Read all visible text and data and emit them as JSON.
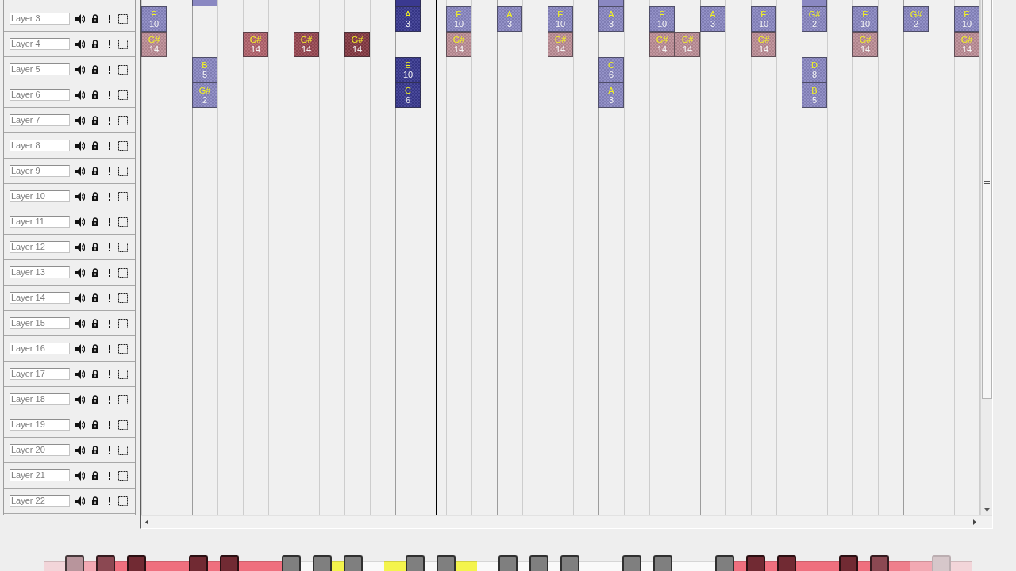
{
  "cut_off_layer": {
    "cells": [
      null,
      null,
      {
        "color": "#8a88c2"
      },
      null,
      null,
      null,
      null,
      null,
      null,
      null,
      {
        "color": "#3a3990"
      },
      null,
      null,
      null,
      null,
      null,
      null,
      null,
      {
        "color": "#8a88c2"
      },
      null,
      null,
      null,
      null,
      null,
      null,
      null,
      {
        "color": "#8a88c2"
      }
    ]
  },
  "layers": [
    {
      "name": "Layer 3",
      "cells": [
        {
          "pitch": "E",
          "number": "10",
          "color": "#8a88c2"
        },
        null,
        null,
        null,
        null,
        null,
        null,
        null,
        null,
        null,
        {
          "pitch": "A",
          "number": "3",
          "color": "#3a3990"
        },
        null,
        {
          "pitch": "E",
          "number": "10",
          "color": "#8a88c2"
        },
        null,
        {
          "pitch": "A",
          "number": "3",
          "color": "#8a88c2"
        },
        null,
        {
          "pitch": "E",
          "number": "10",
          "color": "#8a88c2"
        },
        null,
        {
          "pitch": "A",
          "number": "3",
          "color": "#8a88c2"
        },
        null,
        {
          "pitch": "E",
          "number": "10",
          "color": "#8a88c2"
        },
        null,
        {
          "pitch": "A",
          "number": "3",
          "color": "#8a88c2"
        },
        null,
        {
          "pitch": "E",
          "number": "10",
          "color": "#8a88c2"
        },
        null,
        {
          "pitch": "G#",
          "number": "2",
          "color": "#8a88c2"
        },
        null,
        {
          "pitch": "E",
          "number": "10",
          "color": "#8a88c2"
        },
        null,
        {
          "pitch": "G#",
          "number": "2",
          "color": "#8a88c2"
        },
        null,
        {
          "pitch": "E",
          "number": "10",
          "color": "#8a88c2"
        }
      ]
    },
    {
      "name": "Layer 4",
      "cells": [
        {
          "pitch": "G#",
          "number": "14",
          "color": "#bd8e97"
        },
        null,
        null,
        null,
        {
          "pitch": "G#",
          "number": "14",
          "color": "#b3646e"
        },
        null,
        {
          "pitch": "G#",
          "number": "14",
          "color": "#984852"
        },
        null,
        {
          "pitch": "G#",
          "number": "14",
          "color": "#843943"
        },
        null,
        null,
        null,
        {
          "pitch": "G#",
          "number": "14",
          "color": "#bd8e97"
        },
        null,
        null,
        null,
        {
          "pitch": "G#",
          "number": "14",
          "color": "#bd8e97"
        },
        null,
        null,
        null,
        {
          "pitch": "G#",
          "number": "14",
          "color": "#bd8e97"
        },
        {
          "pitch": "G#",
          "number": "14",
          "color": "#bd8e97"
        },
        null,
        null,
        {
          "pitch": "G#",
          "number": "14",
          "color": "#bd8e97"
        },
        null,
        null,
        null,
        {
          "pitch": "G#",
          "number": "14",
          "color": "#bd8e97"
        },
        null,
        null,
        null,
        {
          "pitch": "G#",
          "number": "14",
          "color": "#bd8e97"
        }
      ]
    },
    {
      "name": "Layer 5",
      "cells": [
        null,
        null,
        {
          "pitch": "B",
          "number": "5",
          "color": "#8a88c2"
        },
        null,
        null,
        null,
        null,
        null,
        null,
        null,
        {
          "pitch": "E",
          "number": "10",
          "color": "#3a3990"
        },
        null,
        null,
        null,
        null,
        null,
        null,
        null,
        {
          "pitch": "C",
          "number": "6",
          "color": "#8a88c2"
        },
        null,
        null,
        null,
        null,
        null,
        null,
        null,
        {
          "pitch": "D",
          "number": "8",
          "color": "#8a88c2"
        }
      ]
    },
    {
      "name": "Layer 6",
      "cells": [
        null,
        null,
        {
          "pitch": "G#",
          "number": "2",
          "color": "#8a88c2"
        },
        null,
        null,
        null,
        null,
        null,
        null,
        null,
        {
          "pitch": "C",
          "number": "6",
          "color": "#3a3990"
        },
        null,
        null,
        null,
        null,
        null,
        null,
        null,
        {
          "pitch": "A",
          "number": "3",
          "color": "#8a88c2"
        },
        null,
        null,
        null,
        null,
        null,
        null,
        null,
        {
          "pitch": "B",
          "number": "5",
          "color": "#8a88c2"
        }
      ]
    },
    {
      "name": "Layer 7"
    },
    {
      "name": "Layer 8"
    },
    {
      "name": "Layer 9"
    },
    {
      "name": "Layer 10"
    },
    {
      "name": "Layer 11"
    },
    {
      "name": "Layer 12"
    },
    {
      "name": "Layer 13"
    },
    {
      "name": "Layer 14"
    },
    {
      "name": "Layer 15"
    },
    {
      "name": "Layer 16"
    },
    {
      "name": "Layer 17"
    },
    {
      "name": "Layer 18"
    },
    {
      "name": "Layer 19"
    },
    {
      "name": "Layer 20"
    },
    {
      "name": "Layer 21"
    },
    {
      "name": "Layer 22"
    }
  ],
  "playhead": {
    "level": 0.3523
  },
  "keyboard": {
    "keys": [
      {
        "kind": "white",
        "color": "#f2d5d9"
      },
      {
        "kind": "black",
        "color": "#b8959c"
      },
      {
        "kind": "white",
        "color": "#f2a9b3"
      },
      {
        "kind": "black",
        "color": "#8b4852"
      },
      {
        "kind": "white",
        "color": "#ef6f7e"
      },
      {
        "kind": "black",
        "color": "#712a33"
      },
      {
        "kind": "white",
        "color": "#ef6f7e"
      },
      {
        "kind": "white",
        "color": "#ef6f7e"
      },
      {
        "kind": "black",
        "color": "#712a33"
      },
      {
        "kind": "white",
        "color": "#ef6f7e"
      },
      {
        "kind": "black",
        "color": "#712a33"
      },
      {
        "kind": "white",
        "color": "#ef6f7e"
      },
      {
        "kind": "white",
        "color": "#ef6f7e"
      },
      {
        "kind": "black",
        "color": "#7f7f7f"
      },
      {
        "kind": "white",
        "color": "#f9f9f9"
      },
      {
        "kind": "black",
        "color": "#7f7f7f"
      },
      {
        "kind": "white",
        "color": "#f4f44c"
      },
      {
        "kind": "black",
        "color": "#7f7f7f"
      },
      {
        "kind": "white",
        "color": "#f9f9f9"
      },
      {
        "kind": "white",
        "color": "#f4f44c"
      },
      {
        "kind": "black",
        "color": "#7f7f7f"
      },
      {
        "kind": "white",
        "color": "#f9f9f9"
      },
      {
        "kind": "black",
        "color": "#7f7f7f"
      },
      {
        "kind": "white",
        "color": "#f4f44c"
      },
      {
        "kind": "white",
        "color": "#f9f9f9"
      },
      {
        "kind": "black",
        "color": "#7f7f7f"
      },
      {
        "kind": "white",
        "color": "#f9f9f9"
      },
      {
        "kind": "black",
        "color": "#7f7f7f"
      },
      {
        "kind": "white",
        "color": "#f9f9f9"
      },
      {
        "kind": "black",
        "color": "#7f7f7f"
      },
      {
        "kind": "white",
        "color": "#f9f9f9"
      },
      {
        "kind": "white",
        "color": "#f9f9f9"
      },
      {
        "kind": "black",
        "color": "#7f7f7f"
      },
      {
        "kind": "white",
        "color": "#f9f9f9"
      },
      {
        "kind": "black",
        "color": "#7f7f7f"
      },
      {
        "kind": "white",
        "color": "#f9f9f9"
      },
      {
        "kind": "white",
        "color": "#f9f9f9"
      },
      {
        "kind": "black",
        "color": "#7f7f7f"
      },
      {
        "kind": "white",
        "color": "#ef6f7e"
      },
      {
        "kind": "black",
        "color": "#712a33"
      },
      {
        "kind": "white",
        "color": "#ef6f7e"
      },
      {
        "kind": "black",
        "color": "#712a33"
      },
      {
        "kind": "white",
        "color": "#ef6f7e"
      },
      {
        "kind": "white",
        "color": "#ef6f7e"
      },
      {
        "kind": "black",
        "color": "#712a33"
      },
      {
        "kind": "white",
        "color": "#ef6f7e"
      },
      {
        "kind": "black",
        "color": "#8b4852"
      },
      {
        "kind": "white",
        "color": "#ef7f8c"
      },
      {
        "kind": "white",
        "color": "#f2a9b3"
      },
      {
        "kind": "black",
        "color": "#d6c7ca"
      },
      {
        "kind": "white",
        "color": "#f2d5d9"
      }
    ]
  }
}
